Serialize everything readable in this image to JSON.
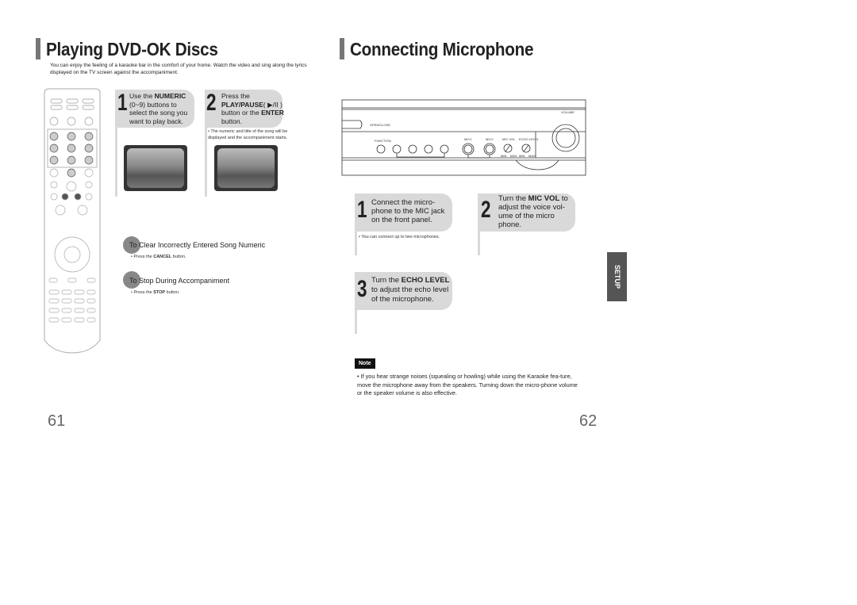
{
  "left": {
    "title": "Playing DVD-OK Discs",
    "intro": "You can enjoy the feeling of a karaoke bar in the comfort of your home. Watch the video and sing along the lyrics displayed on the TV screen against the accompaniment.",
    "step1": {
      "num": "1",
      "text_a": "Use the ",
      "bold": "NUMERIC",
      "text_b": " (0~9) buttons to select the song you want to play back."
    },
    "step2": {
      "num": "2",
      "text_a": "Press the ",
      "bold_a": "PLAY/PAUSE",
      "text_b": "( ▶/II ) button or the ",
      "bold_b": "ENTER",
      "text_c": " button.",
      "note": "• The numeric and title of the song will be displayed and the accompaniment starts."
    },
    "clear": {
      "heading": "To Clear Incorrectly Entered Song Numeric",
      "bullet_a": "• Press the ",
      "bullet_bold": "CANCEL",
      "bullet_b": " button."
    },
    "stop": {
      "heading": "To Stop During Accompaniment",
      "bullet_a": "• Press the ",
      "bullet_bold": "STOP",
      "bullet_b": " button."
    },
    "page": "61"
  },
  "right": {
    "title": "Connecting Microphone",
    "panel": {
      "volume": "VOLUME",
      "open_close": "OPEN/CLOSE",
      "function": "FUNCTION",
      "mic1": "MIC1",
      "mic2": "MIC2",
      "mic_vol": "MIC VOL",
      "echo_level": "ECHO LEVEL",
      "min": "MIN",
      "max": "MAX"
    },
    "step1": {
      "num": "1",
      "text": "Connect the micro-phone to the MIC jack on the front panel.",
      "note": "• You can connect up to two microphones."
    },
    "step2": {
      "num": "2",
      "text_a": "Turn the ",
      "bold": "MIC VOL",
      "text_b": " to adjust the voice vol-ume of the micro phone."
    },
    "step3": {
      "num": "3",
      "text_a": "Turn the ",
      "bold": "ECHO LEVEL",
      "text_b": " to adjust the echo level of the microphone."
    },
    "note_label": "Note",
    "note_text": "• If you hear strange noises (squealing or howling) while using the Karaoke fea-ture, move the microphone away from the speakers. Turning down the micro-phone volume or the speaker volume is also effective.",
    "page": "62",
    "side_tab": "SETUP"
  }
}
